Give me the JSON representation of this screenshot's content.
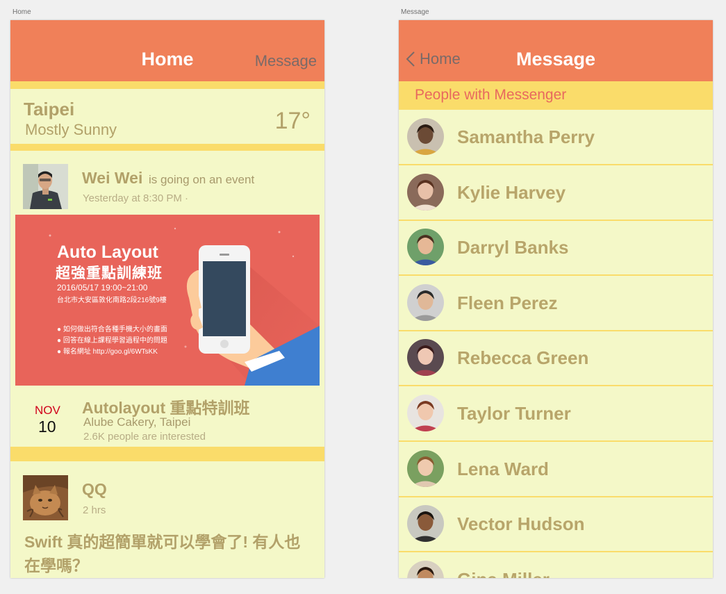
{
  "artboards": {
    "home_label": "Home",
    "message_label": "Message"
  },
  "home": {
    "nav": {
      "title": "Home",
      "right_link": "Message"
    },
    "weather": {
      "city": "Taipei",
      "condition": "Mostly Sunny",
      "temperature": "17°"
    },
    "post1": {
      "author": "Wei Wei",
      "action": "is going on an event",
      "time": "Yesterday at 8:30 PM ·",
      "image": {
        "title": "Auto Layout",
        "subtitle": "超強重點訓練班",
        "datetime": "2016/05/17  19:00~21:00",
        "address": "台北市大安區敦化南路2段216號9樓",
        "bullets": [
          "● 如何做出符合各種手機大小的畫面",
          "● 回答在線上課程學習過程中的問題",
          "● 報名網址  http://goo.gl/6WTsKK"
        ]
      },
      "event": {
        "month": "NOV",
        "day": "10",
        "name": "Autolayout 重點特訓班",
        "venue": "Alube Cakery, Taipei",
        "interested": "2.6K people are interested"
      }
    },
    "post2": {
      "author": "QQ",
      "time": "2 hrs",
      "body": "Swift 真的超簡單就可以學會了! 有人也在學嗎？"
    }
  },
  "message": {
    "nav": {
      "back_label": "Home",
      "title": "Message"
    },
    "section_title": "People with Messenger",
    "contacts": [
      {
        "name": "Samantha Perry"
      },
      {
        "name": "Kylie Harvey"
      },
      {
        "name": "Darryl Banks"
      },
      {
        "name": "Fleen Perez"
      },
      {
        "name": "Rebecca Green"
      },
      {
        "name": "Taylor Turner"
      },
      {
        "name": "Lena Ward"
      },
      {
        "name": "Vector Hudson"
      },
      {
        "name": "Gina Miller"
      }
    ]
  },
  "colors": {
    "nav": "#f08059",
    "accent_yellow": "#fadc6a",
    "background": "#f4f8c8",
    "text": "#b2a169",
    "section_text": "#e8695e",
    "date_red": "#d0021b"
  }
}
